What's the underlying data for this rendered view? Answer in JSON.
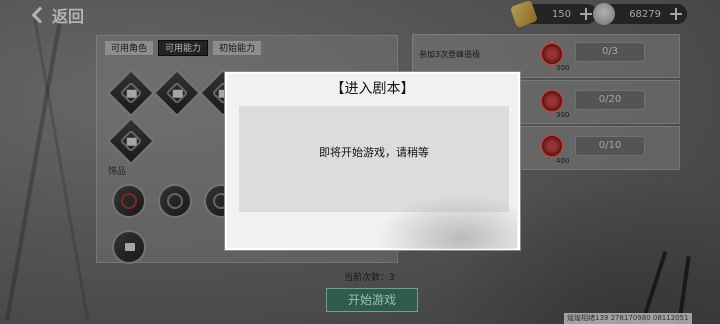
{
  "header": {
    "back_label": "返回",
    "resources": [
      {
        "icon": "gold-ingot-icon",
        "value": "150"
      },
      {
        "icon": "silver-ingot-icon",
        "value": "68279"
      }
    ]
  },
  "left_panel": {
    "tabs": [
      {
        "label": "可用角色",
        "active": false
      },
      {
        "label": "可用能力",
        "active": true
      },
      {
        "label": "初始能力",
        "active": false
      }
    ],
    "accessories_label": "饰品"
  },
  "quests": [
    {
      "text": "参加3次登峰造极",
      "progress": "0/3",
      "reward_count": "300"
    },
    {
      "text": "",
      "progress": "0/20",
      "reward_count": "300"
    },
    {
      "text": "",
      "progress": "0/10",
      "reward_count": "400"
    }
  ],
  "counter": "当前次数：3",
  "start_button": "开始游戏",
  "modal": {
    "title": "【进入剧本】",
    "message": "即将开始游戏，请稍等"
  },
  "watermark": "煌煌相绪139 278170980 08112051"
}
